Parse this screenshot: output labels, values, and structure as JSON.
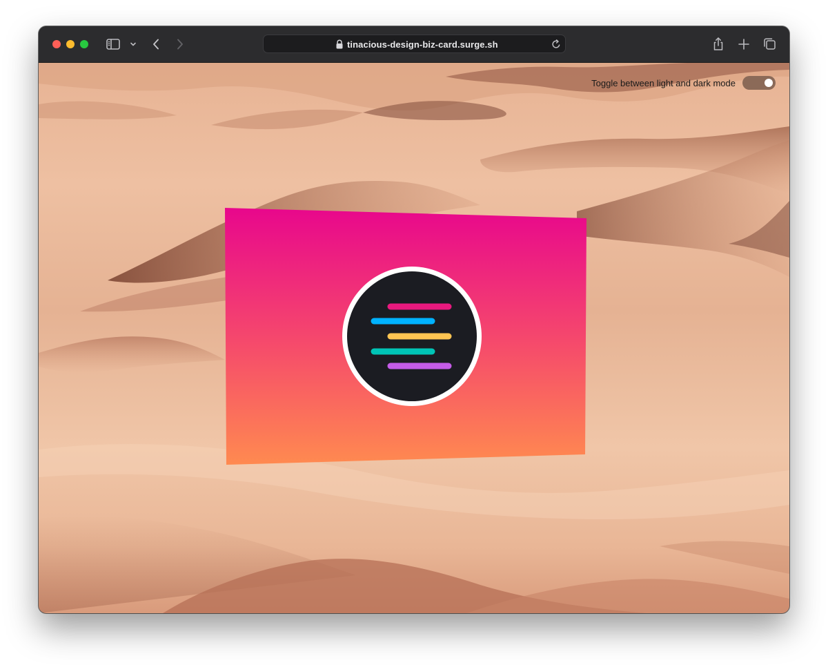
{
  "browser": {
    "url": "tinacious-design-biz-card.surge.sh",
    "icons": {
      "close": "close-window-icon",
      "minimize": "minimize-window-icon",
      "zoom": "zoom-window-icon",
      "sidebar": "sidebar-icon",
      "sidebar_menu": "chevron-down-icon",
      "back": "back-arrow-icon",
      "forward": "forward-arrow-icon",
      "lock": "lock-icon",
      "reload": "reload-icon",
      "share": "share-icon",
      "new_tab": "plus-icon",
      "tab_overview": "tabs-overview-icon"
    },
    "colors": {
      "close": "#ff5f57",
      "minimize": "#febc2e",
      "zoom": "#28c840"
    }
  },
  "page": {
    "theme_toggle": {
      "label": "Toggle between light and dark mode",
      "state": "on"
    },
    "card": {
      "gradient": [
        "#e8078c",
        "#ff8a50"
      ],
      "logo": {
        "background": "#1b1c22",
        "ring": "#ffffff",
        "bar_colors": [
          "#e8197e",
          "#00b2ff",
          "#ffc552",
          "#00c4b6",
          "#c55ce8"
        ]
      }
    }
  }
}
